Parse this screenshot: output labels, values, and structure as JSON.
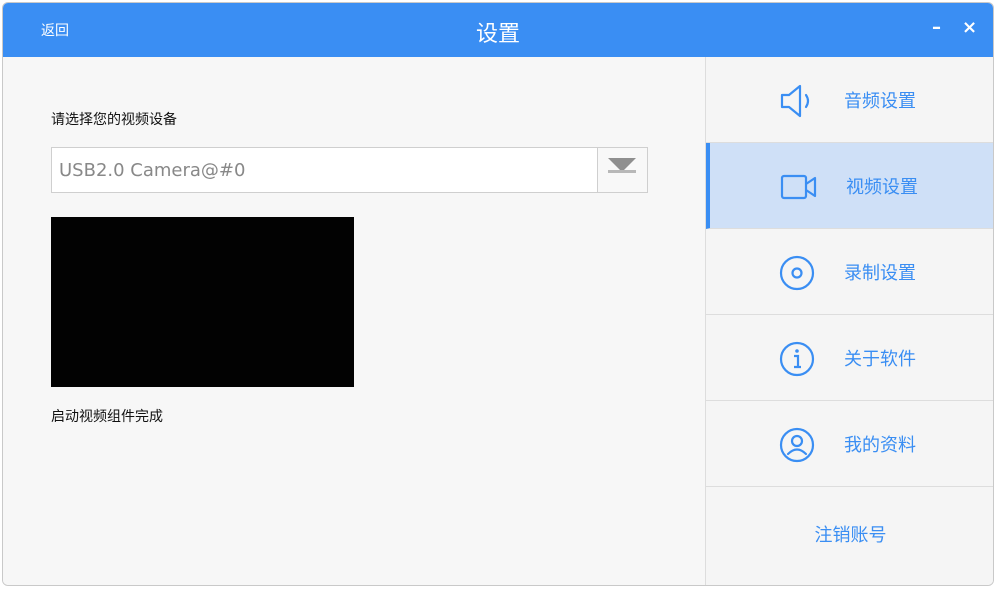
{
  "window": {
    "title": "设置",
    "back_label": "返回",
    "minimize_glyph": "–",
    "close_glyph": "×"
  },
  "video": {
    "device_label": "请选择您的视频设备",
    "selected_device": "USB2.0 Camera@#0",
    "status": "启动视频组件完成"
  },
  "sidebar": {
    "items": [
      {
        "label": "音频设置",
        "icon": "speaker-icon",
        "active": false
      },
      {
        "label": "视频设置",
        "icon": "camera-icon",
        "active": true
      },
      {
        "label": "录制设置",
        "icon": "record-icon",
        "active": false
      },
      {
        "label": "关于软件",
        "icon": "info-icon",
        "active": false
      },
      {
        "label": "我的资料",
        "icon": "user-icon",
        "active": false
      }
    ],
    "logout_label": "注销账号"
  },
  "colors": {
    "accent": "#3a8ef3",
    "active_bg": "#cfe0f7"
  }
}
